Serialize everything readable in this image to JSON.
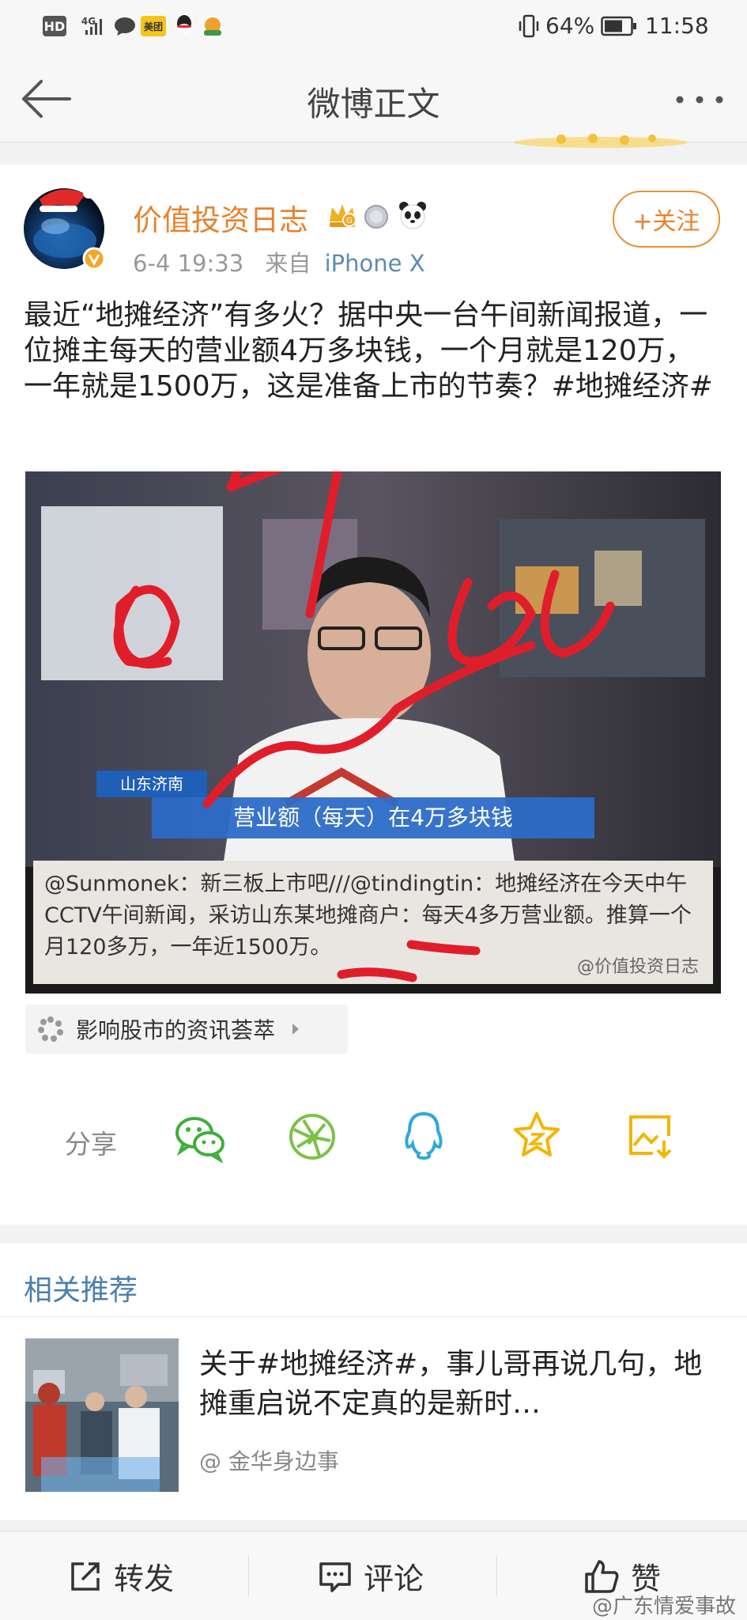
{
  "status_bar": {
    "left_badges": [
      "HD",
      "4G",
      "美团"
    ],
    "battery": "64%",
    "time": "11:58"
  },
  "header": {
    "title": "微博正文"
  },
  "post": {
    "author": "价值投资日志",
    "date": "6-4 19:33",
    "source_prefix": "来自",
    "source": "iPhone X",
    "follow_label": "+关注",
    "text": "最近“地摊经济”有多火？据中央一台午间新闻报道，一位摊主每天的营业额4万多块钱，一个月就是120万，一年就是1500万，这是准备上市的节奏？#地摊经济#",
    "image": {
      "tv_location_label": "山东济南",
      "tv_subtitle": "营业额（每天）在4万多块钱",
      "caption": "@Sunmonek：新三板上市吧///@tindingtin：地摊经济在今天中午CCTV午间新闻，采访山东某地摊商户：每天4多万营业额。推算一个月120多万，一年近1500万。",
      "watermark": "@价值投资日志"
    },
    "topic_chip": "影响股市的资讯荟萃",
    "share_label": "分享"
  },
  "recommend": {
    "title": "相关推荐",
    "headline": "关于#地摊经济#，事儿哥再说几句，地摊重启说不定真的是新时…",
    "source": "@ 金华身边事"
  },
  "bottom_bar": {
    "repost": "转发",
    "comment": "评论",
    "like": "赞",
    "watermark": "@广东情爱事故"
  },
  "colors": {
    "accent_orange": "#e8812b",
    "link_blue": "#4a7fae",
    "annotation_red": "#e01e2b"
  }
}
